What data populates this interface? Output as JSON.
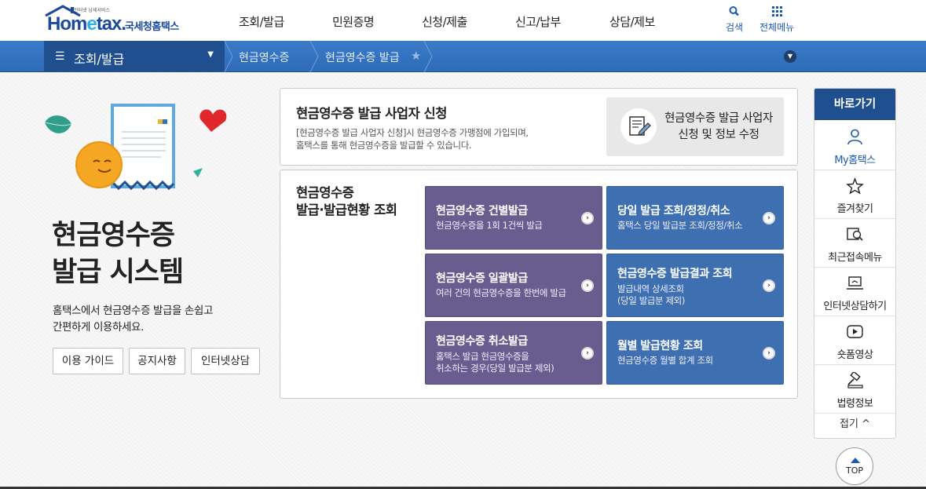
{
  "header": {
    "logo_tagline": "인터넷 납세서비스",
    "logo_brand_1": "Hom",
    "logo_brand_e": "e",
    "logo_brand_2": "tax.",
    "logo_korean": "국세청홈택스",
    "gnb": [
      "조회/발급",
      "민원증명",
      "신청/제출",
      "신고/납부",
      "상담/제보"
    ],
    "search_label": "검색",
    "allmenu_label": "전체메뉴"
  },
  "subnav": {
    "menu_title": "조회/발급",
    "crumb_1": "현금영수증",
    "crumb_2": "현금영수증 발급"
  },
  "hero": {
    "title_line1": "현금영수증",
    "title_line2": "발급 시스템",
    "desc_line1": "홈택스에서 현금영수증 발급을 손쉽고",
    "desc_line2": "간편하게 이용하세요.",
    "buttons": [
      "이용 가이드",
      "공지사항",
      "인터넷상담"
    ]
  },
  "apply_panel": {
    "title": "현금영수증 발급 사업자 신청",
    "desc_line1": "[현금영수증 발급 사업자 신청]시 현금영수증 가맹점에 가입되며,",
    "desc_line2": "홈택스를 통해 현금영수증을 발급할 수 있습니다.",
    "button_line1": "현금영수증 발급 사업자",
    "button_line2": "신청 및 정보 수정"
  },
  "issue_panel": {
    "title_line1": "현금영수증",
    "title_line2": "발급·발급현황 조회",
    "tiles": [
      {
        "title": "현금영수증 건별발급",
        "sub1": "현금영수증을 1회 1건씩 발급",
        "sub2": ""
      },
      {
        "title": "당일 발급 조회/정정/취소",
        "sub1": "홈택스 당일 발급분 조회/정정/취소",
        "sub2": ""
      },
      {
        "title": "현금영수증 일괄발급",
        "sub1": "여러 건의 현금영수증을 한번에 발급",
        "sub2": ""
      },
      {
        "title": "현금영수증 발급결과 조회",
        "sub1": "발급내역 상세조회",
        "sub2": "(당일 발급분 제외)"
      },
      {
        "title": "현금영수증 취소발급",
        "sub1": "홈택스 발급 현금영수증을",
        "sub2": "취소하는 경우(당일 발급분 제외)"
      },
      {
        "title": "월별 발급현황 조회",
        "sub1": "현금영수증 월별 합계 조회",
        "sub2": ""
      }
    ]
  },
  "quick": {
    "header": "바로가기",
    "items": [
      {
        "label": "My홈택스",
        "icon": "person-icon"
      },
      {
        "label": "즐겨찾기",
        "icon": "star-icon"
      },
      {
        "label": "최근접속메뉴",
        "icon": "recent-search-icon"
      },
      {
        "label": "인터넷상담하기",
        "icon": "laptop-icon"
      },
      {
        "label": "숏폼영상",
        "icon": "play-icon"
      },
      {
        "label": "법령정보",
        "icon": "gavel-icon"
      }
    ],
    "fold_label": "접기 ^"
  },
  "top_button": "TOP",
  "colors": {
    "brand_blue": "#1a4a9c",
    "subnav_blue": "#2f6bb8",
    "tile_purple": "#695c8e",
    "tile_blue": "#3e6fb1",
    "quick_header": "#1f4f8e"
  }
}
